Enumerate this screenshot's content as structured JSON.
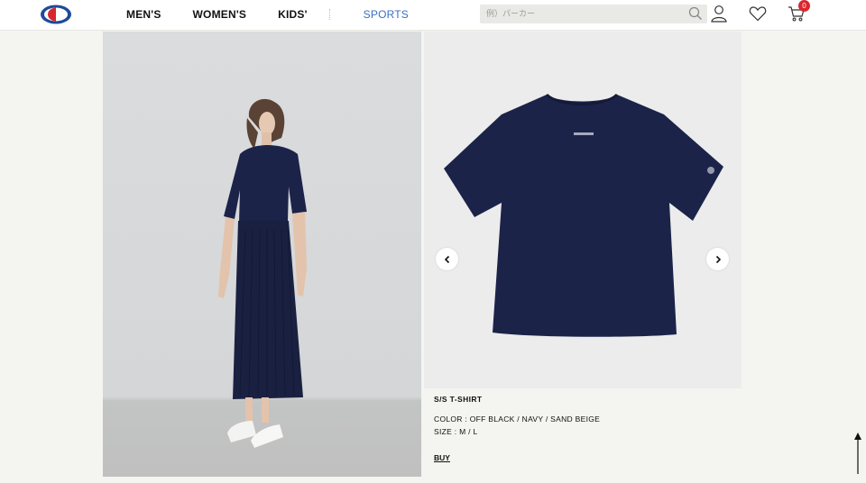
{
  "header": {
    "nav": [
      "MEN'S",
      "WOMEN'S",
      "KIDS'",
      "SPORTS"
    ],
    "search_placeholder": "例）パーカー",
    "cart_count": "0"
  },
  "icons": {
    "logo": "champion-logo-icon",
    "search": "search-icon",
    "account": "user-icon",
    "favorites": "heart-icon",
    "cart": "cart-icon",
    "prev": "chevron-left-icon",
    "next": "chevron-right-icon",
    "top": "arrow-up-icon"
  },
  "product": {
    "name": "S/S T-SHIRT",
    "color": "COLOR : OFF BLACK / NAVY / SAND BEIGE",
    "size": "SIZE : M / L",
    "buy_label": "BUY"
  },
  "colors": {
    "brand_red": "#d9262e",
    "brand_blue": "#1d4b9a",
    "navy": "#1c2349",
    "sports_link": "#3b6fc2"
  }
}
